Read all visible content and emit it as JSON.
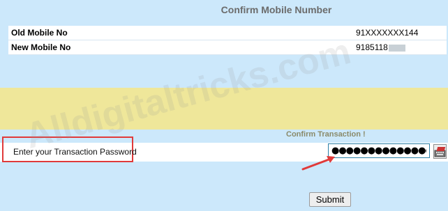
{
  "page": {
    "title": "Confirm Mobile Number"
  },
  "mobile_info": {
    "rows": [
      {
        "label": "Old Mobile No",
        "value": "91XXXXXXX144"
      },
      {
        "label": "New Mobile No",
        "value": "9185118"
      }
    ]
  },
  "transaction": {
    "heading": "Confirm Transaction !",
    "password_label": "Enter your Transaction Password",
    "password_value": "●●●●●●●●●●●●●●"
  },
  "watermark": "Alldigitaltricks.com",
  "actions": {
    "submit_label": "Submit"
  },
  "colors": {
    "page_bg": "#cce8fb",
    "band_bg": "#efe79a",
    "highlight": "#e03a3a"
  },
  "icons": {
    "virtual_keyboard": "keyboard-icon",
    "annotation": "arrow-icon"
  }
}
